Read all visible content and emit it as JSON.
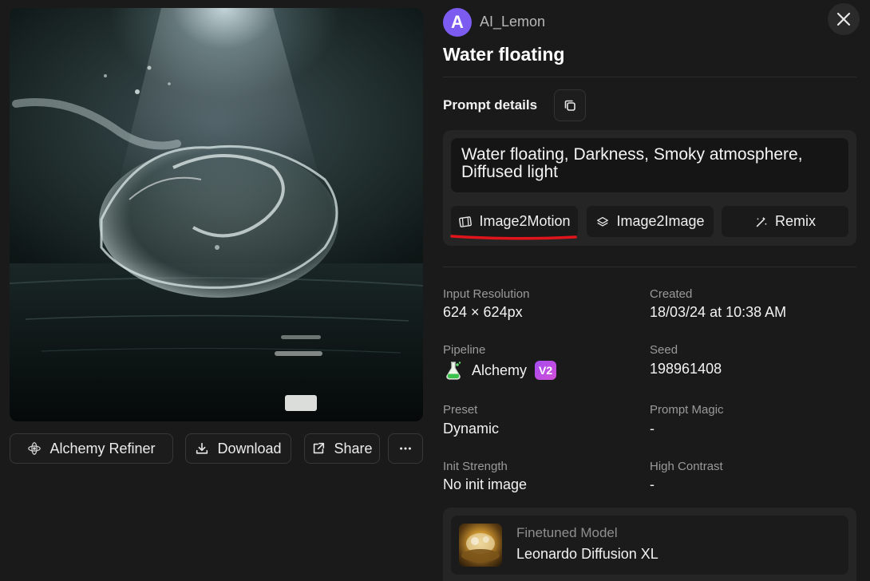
{
  "user": {
    "avatar_letter": "A",
    "name": "AI_Lemon"
  },
  "generation": {
    "title": "Water floating"
  },
  "actions": {
    "alchemy_refiner": "Alchemy Refiner",
    "download": "Download",
    "share": "Share",
    "more_icon": "more-horizontal-icon"
  },
  "prompt": {
    "label": "Prompt details",
    "text": "Water floating, Darkness, Smoky atmosphere, Diffused light",
    "buttons": {
      "image2motion": "Image2Motion",
      "image2image": "Image2Image",
      "remix": "Remix"
    }
  },
  "details": {
    "input_resolution": {
      "label": "Input Resolution",
      "value": "624 × 624px"
    },
    "created": {
      "label": "Created",
      "value": "18/03/24 at 10:38 AM"
    },
    "pipeline": {
      "label": "Pipeline",
      "value": "Alchemy",
      "badge": "V2"
    },
    "seed": {
      "label": "Seed",
      "value": "198961408"
    },
    "preset": {
      "label": "Preset",
      "value": "Dynamic"
    },
    "prompt_magic": {
      "label": "Prompt Magic",
      "value": "-"
    },
    "init_strength": {
      "label": "Init Strength",
      "value": "No init image"
    },
    "high_contrast": {
      "label": "High Contrast",
      "value": "-"
    }
  },
  "model": {
    "label": "Finetuned Model",
    "name": "Leonardo Diffusion XL"
  },
  "colors": {
    "background": "#1a1a1a",
    "avatar": "#7c5cf0",
    "badge_gradient_start": "#a64bf0",
    "badge_gradient_end": "#d14fd8",
    "annotation_underline": "#e0141b"
  }
}
